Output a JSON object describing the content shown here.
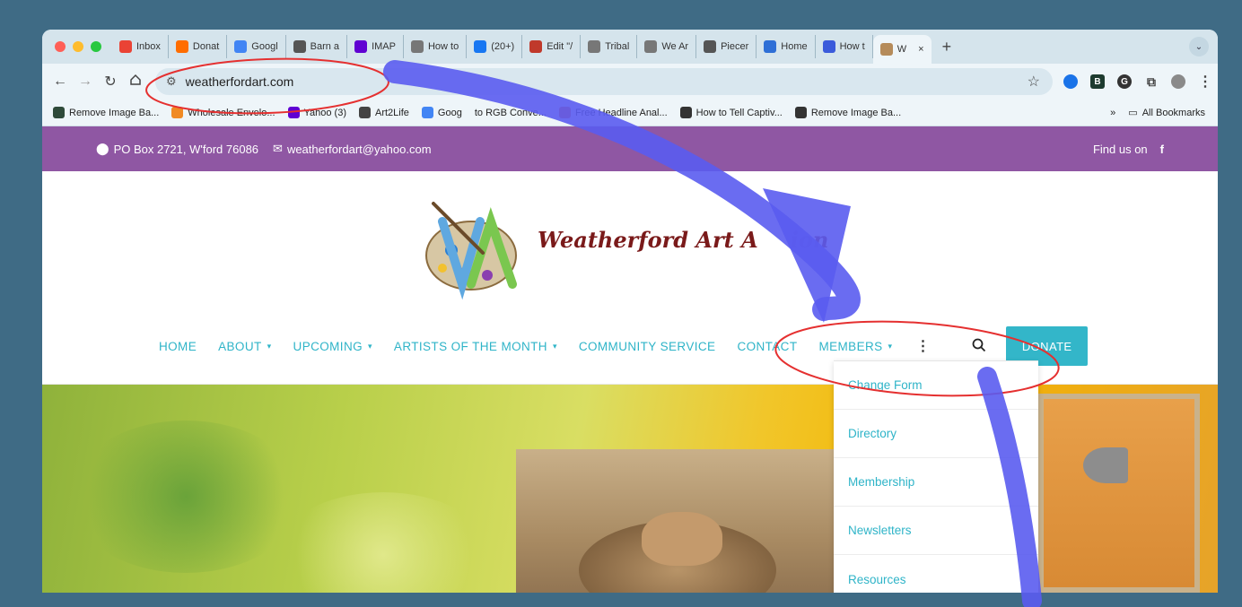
{
  "browser": {
    "tabs": [
      {
        "label": "Inbox",
        "icon": "gmail-icon",
        "color": "#ea4335"
      },
      {
        "label": "Donat",
        "icon": "donate-icon",
        "color": "#ff6d00"
      },
      {
        "label": "Googl",
        "icon": "calendar-icon",
        "color": "#4285f4"
      },
      {
        "label": "Barn a",
        "icon": "barn-icon",
        "color": "#555555"
      },
      {
        "label": "IMAP",
        "icon": "yahoo-icon",
        "color": "#6001d2"
      },
      {
        "label": "How to",
        "icon": "globe-icon",
        "color": "#777777"
      },
      {
        "label": "(20+)",
        "icon": "facebook-icon",
        "color": "#1877f2"
      },
      {
        "label": "Edit \"/",
        "icon": "edit-icon",
        "color": "#c0392b"
      },
      {
        "label": "Tribal",
        "icon": "globe-icon",
        "color": "#777777"
      },
      {
        "label": "We Ar",
        "icon": "globe-icon",
        "color": "#777777"
      },
      {
        "label": "Piecer",
        "icon": "piecer-icon",
        "color": "#555555"
      },
      {
        "label": "Home",
        "icon": "home-tab-icon",
        "color": "#2f6fd6"
      },
      {
        "label": "How t",
        "icon": "print-icon",
        "color": "#3b5bdb"
      },
      {
        "label": "W",
        "icon": "butterfly-icon",
        "color": "#b58b5a"
      }
    ],
    "url": "weatherfordart.com",
    "bookmarks": [
      {
        "label": "Remove Image Ba...",
        "icon": "b-icon",
        "color": "#2e4a3a"
      },
      {
        "label": "Wholesale Envelo...",
        "icon": "leaf-icon",
        "color": "#f08a24"
      },
      {
        "label": "Yahoo (3)",
        "icon": "yahoo-icon",
        "color": "#6001d2"
      },
      {
        "label": "Art2Life",
        "icon": "a2l-icon",
        "color": "#444444"
      },
      {
        "label": "Goog",
        "icon": "google-icon",
        "color": "#4285f4"
      },
      {
        "label": "to RGB Conve...",
        "icon": "",
        "color": ""
      },
      {
        "label": "Free Headline Anal...",
        "icon": "check-icon",
        "color": "#e8613c"
      },
      {
        "label": "How to Tell Captiv...",
        "icon": "globe-icon",
        "color": "#333333"
      },
      {
        "label": "Remove Image Ba...",
        "icon": "globe-icon",
        "color": "#333333"
      }
    ],
    "more_bookmarks": "»",
    "all_bookmarks": "All Bookmarks"
  },
  "site": {
    "topbar": {
      "address": "PO Box 2721, W'ford 76086",
      "email": "weatherfordart@yahoo.com",
      "find_us": "Find us on",
      "social": "f"
    },
    "title": "Weatherford Art A",
    "title_end": "ion",
    "nav": [
      {
        "label": "HOME",
        "has_dropdown": false
      },
      {
        "label": "ABOUT",
        "has_dropdown": true
      },
      {
        "label": "UPCOMING",
        "has_dropdown": true
      },
      {
        "label": "ARTISTS OF THE MONTH",
        "has_dropdown": true
      },
      {
        "label": "COMMUNITY SERVICE",
        "has_dropdown": false
      },
      {
        "label": "CONTACT",
        "has_dropdown": false
      },
      {
        "label": "MEMBERS",
        "has_dropdown": true
      }
    ],
    "donate": "DONATE",
    "members_menu": [
      "Change Form",
      "Directory",
      "Membership",
      "Newsletters",
      "Resources"
    ]
  },
  "colors": {
    "accent": "#33b6c9",
    "topbar": "#8f57a3",
    "annotation_red": "#e53030",
    "annotation_blue": "#5a5cf0",
    "title": "#7a1a1a"
  }
}
